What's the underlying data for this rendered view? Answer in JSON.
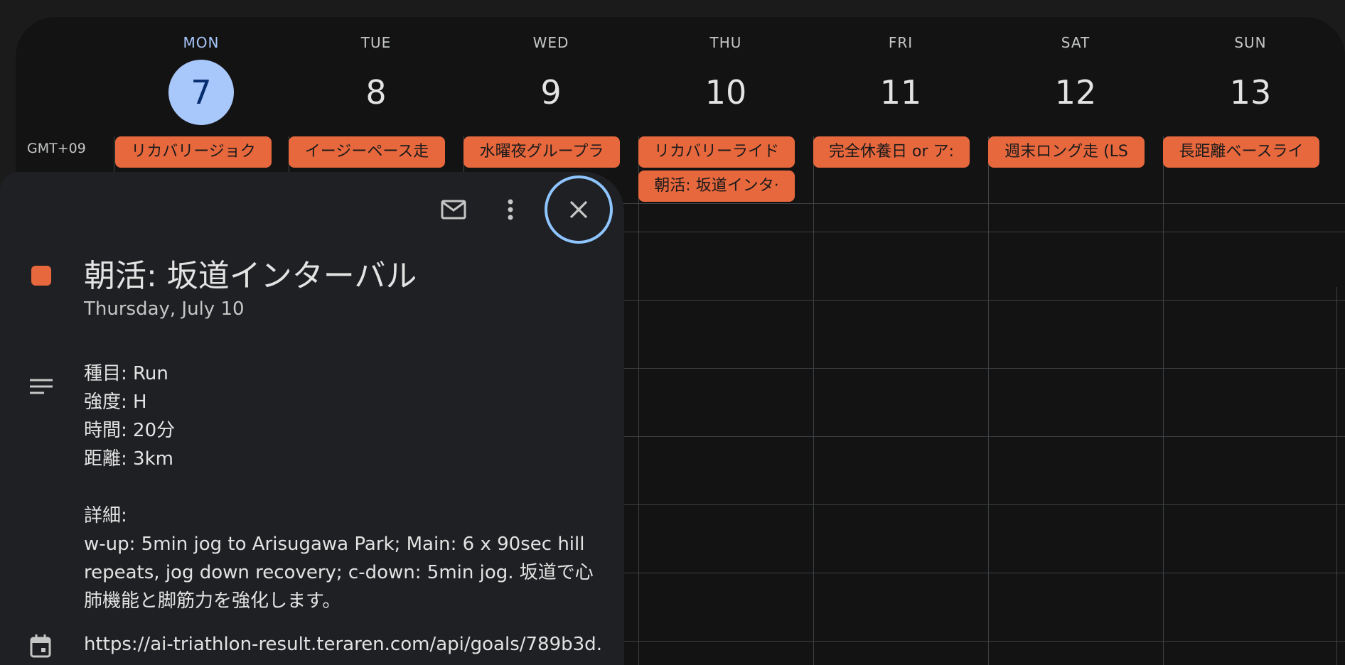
{
  "timezone": "GMT+09",
  "days": [
    {
      "dow": "MON",
      "num": "7",
      "today": true
    },
    {
      "dow": "TUE",
      "num": "8"
    },
    {
      "dow": "WED",
      "num": "9"
    },
    {
      "dow": "THU",
      "num": "10"
    },
    {
      "dow": "FRI",
      "num": "11"
    },
    {
      "dow": "SAT",
      "num": "12"
    },
    {
      "dow": "SUN",
      "num": "13"
    }
  ],
  "events": {
    "mon": "リカバリージョク",
    "tue": "イージーペース走",
    "wed": "水曜夜グループラ",
    "thu": "リカバリーライド",
    "thu2": "朝活: 坂道インタ·",
    "fri": "完全休養日 or ア:",
    "sat": "週末ロング走 (LS",
    "sun": "長距離ベースライ"
  },
  "detail": {
    "title": "朝活: 坂道インターバル",
    "date": "Thursday, July 10",
    "lines": [
      "種目: Run",
      "強度: H",
      "時間: 20分",
      "距離: 3km"
    ],
    "details_label": "詳細:",
    "details_text": [
      "w-up: 5min jog to Arisugawa Park; Main: 6 x 90sec hill",
      "repeats, jog down recovery; c-down: 5min jog. 坂道で心",
      "肺機能と脚筋力を強化します。"
    ],
    "link": "https://ai-triathlon-result.teraren.com/api/goals/789b3d..."
  },
  "colors": {
    "event": "#e8683e",
    "today": "#a8c7fa",
    "focus_ring": "#8ec5ff"
  },
  "icons": [
    "mail-icon",
    "more-vert-icon",
    "close-icon",
    "notes-icon",
    "calendar-icon"
  ]
}
